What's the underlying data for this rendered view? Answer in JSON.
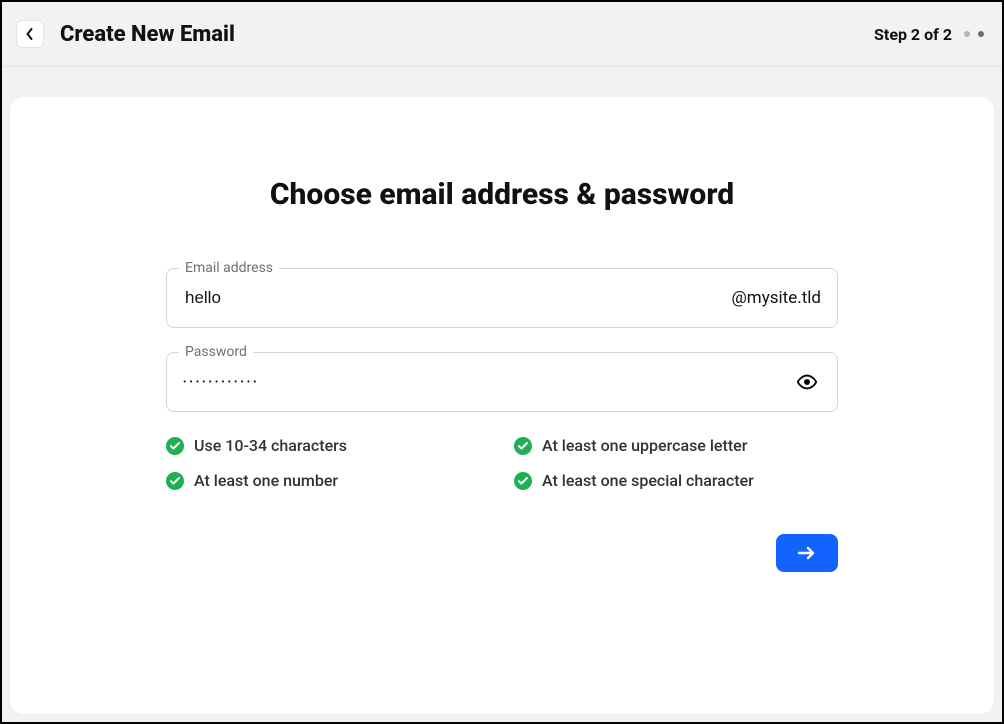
{
  "header": {
    "title": "Create New Email",
    "step_text": "Step 2 of 2"
  },
  "page": {
    "heading": "Choose email address & password"
  },
  "email": {
    "label": "Email address",
    "value": "hello",
    "domain": "@mysite.tld"
  },
  "password": {
    "label": "Password",
    "mask": "••••••••••••",
    "requirements": [
      {
        "text": "Use 10-34 characters",
        "met": true
      },
      {
        "text": "At least one uppercase letter",
        "met": true
      },
      {
        "text": "At least one number",
        "met": true
      },
      {
        "text": "At least one special character",
        "met": true
      }
    ]
  },
  "colors": {
    "accent": "#1263ff",
    "success": "#1eb053"
  }
}
